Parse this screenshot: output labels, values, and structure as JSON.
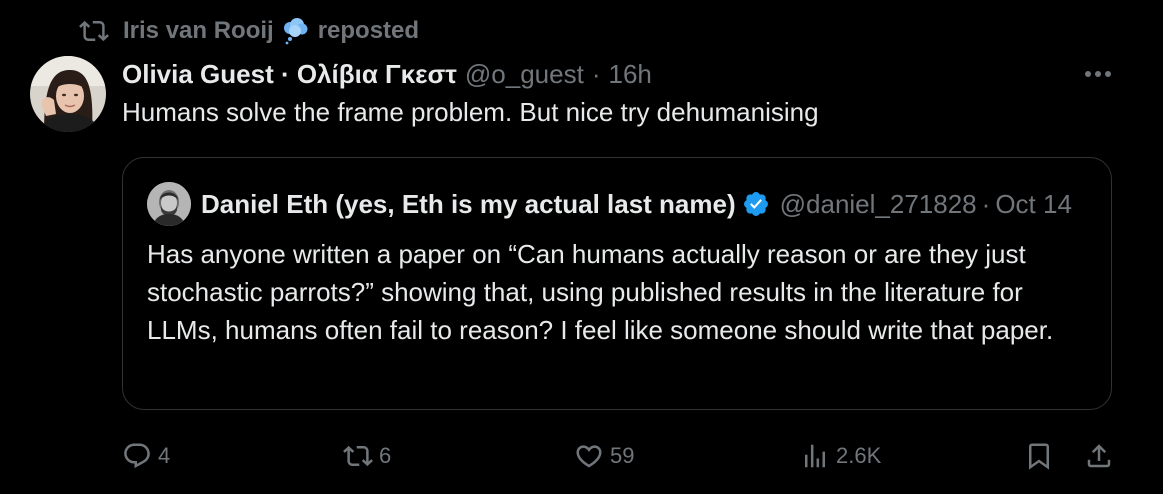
{
  "repost": {
    "icon": "repost-icon",
    "user": "Iris van Rooij",
    "badge_icon": "thought-bubble-icon",
    "label": "reposted"
  },
  "post": {
    "avatar_icon": "user-avatar",
    "author": "Olivia Guest · Ολίβια Γκεστ",
    "handle": "@o_guest",
    "separator": "·",
    "time": "16h",
    "more_icon": "more-options-icon",
    "text": "Humans solve the frame problem. But nice try dehumanising"
  },
  "quote": {
    "avatar_icon": "user-avatar",
    "author": "Daniel Eth (yes, Eth is my actual last name)",
    "verified_icon": "verified-badge-icon",
    "handle": "@daniel_271828",
    "separator": "·",
    "date": "Oct 14",
    "text": "Has anyone written a paper on “Can humans actually reason or are they just stochastic parrots?” showing that, using published results in the literature for LLMs, humans often fail to reason? I feel like someone should write that paper."
  },
  "actions": {
    "reply": {
      "icon": "reply-icon",
      "count": "4"
    },
    "repost": {
      "icon": "repost-icon",
      "count": "6"
    },
    "like": {
      "icon": "heart-icon",
      "count": "59"
    },
    "views": {
      "icon": "analytics-icon",
      "count": "2.6K"
    },
    "bookmark": {
      "icon": "bookmark-icon"
    },
    "share": {
      "icon": "share-icon"
    }
  },
  "colors": {
    "background": "#000000",
    "text_primary": "#e7e9ea",
    "text_secondary": "#71767b",
    "border": "#2f3336",
    "verified": "#1d9bf0"
  }
}
